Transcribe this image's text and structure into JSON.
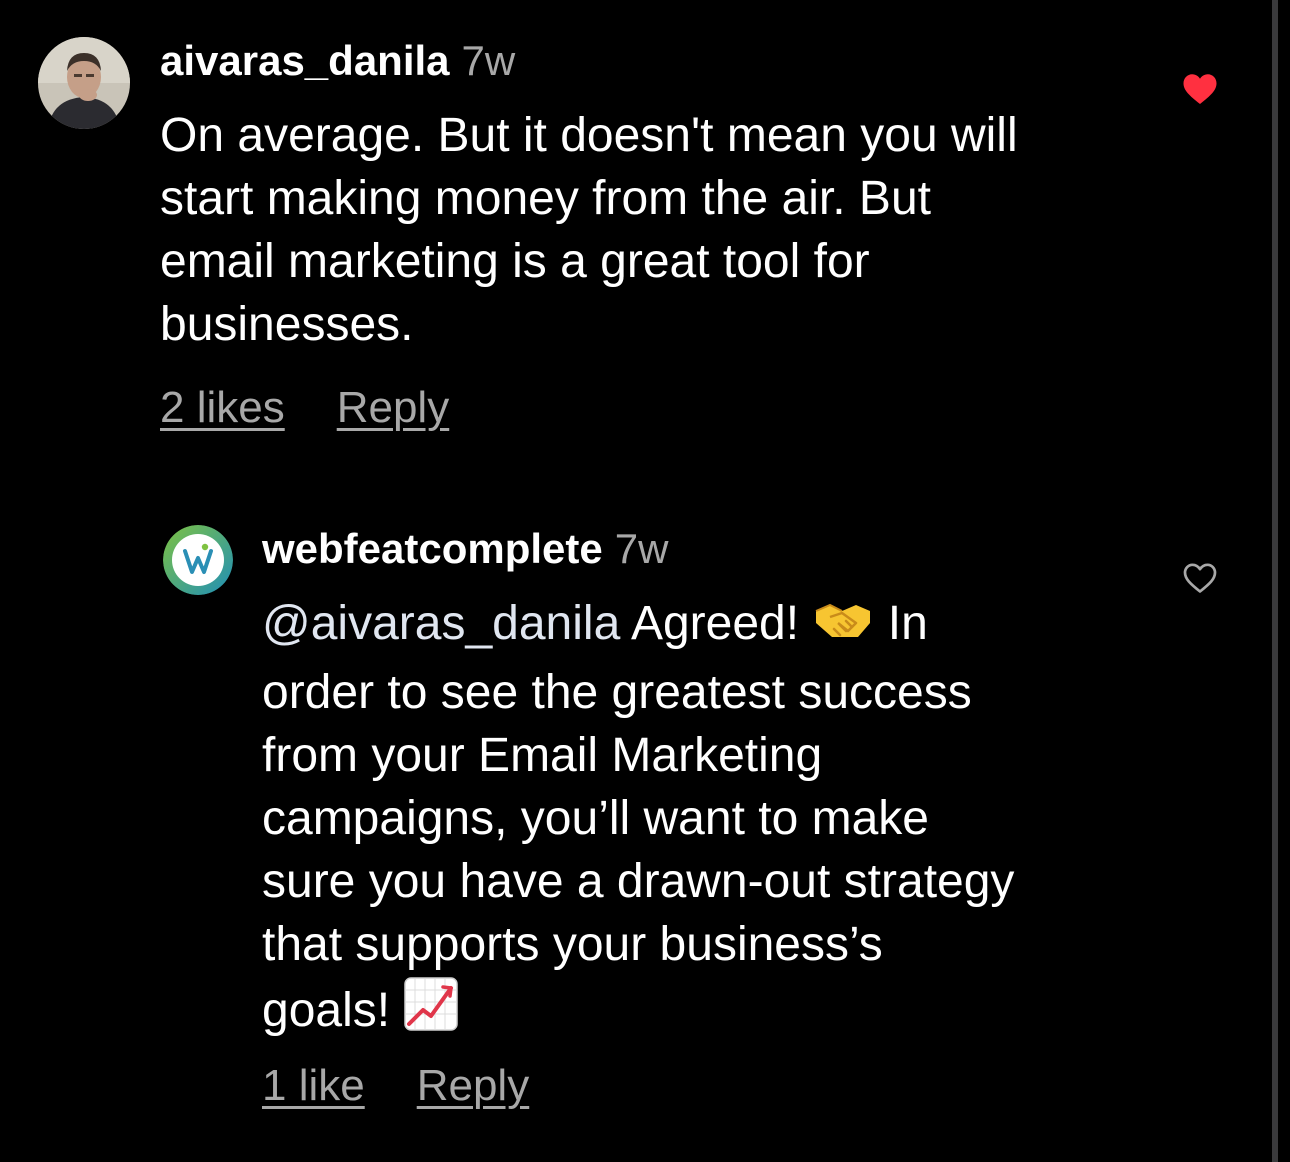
{
  "comments": [
    {
      "username": "aivaras_danila",
      "time": "7w",
      "text_lines": [
        "On average. But it doesn't mean you will",
        "start making money from the air. But",
        "email marketing is a great tool for",
        "businesses."
      ],
      "likes_label": "2 likes",
      "reply_label": "Reply",
      "liked": true,
      "avatar_icon": "user-photo-avatar"
    },
    {
      "username": "webfeatcomplete",
      "time": "7w",
      "mention": "@aivaras_danila",
      "text_line1_after_mention": " Agreed! ",
      "text_line1_end": " In",
      "emoji_1": "handshake-emoji",
      "text_lines": [
        "order to see the greatest success",
        "from your Email Marketing",
        "campaigns, you’ll want to make",
        "sure you have a drawn-out strategy",
        "that supports your business’s"
      ],
      "last_line": "goals! ",
      "emoji_2": "chart-increasing-emoji",
      "likes_label": "1 like",
      "reply_label": "Reply",
      "liked": false,
      "avatar_icon": "webfeat-logo-avatar"
    }
  ],
  "colors": {
    "background": "#000000",
    "text": "#ffffff",
    "secondary": "#a8a8a8",
    "liked_heart": "#ff3040"
  }
}
